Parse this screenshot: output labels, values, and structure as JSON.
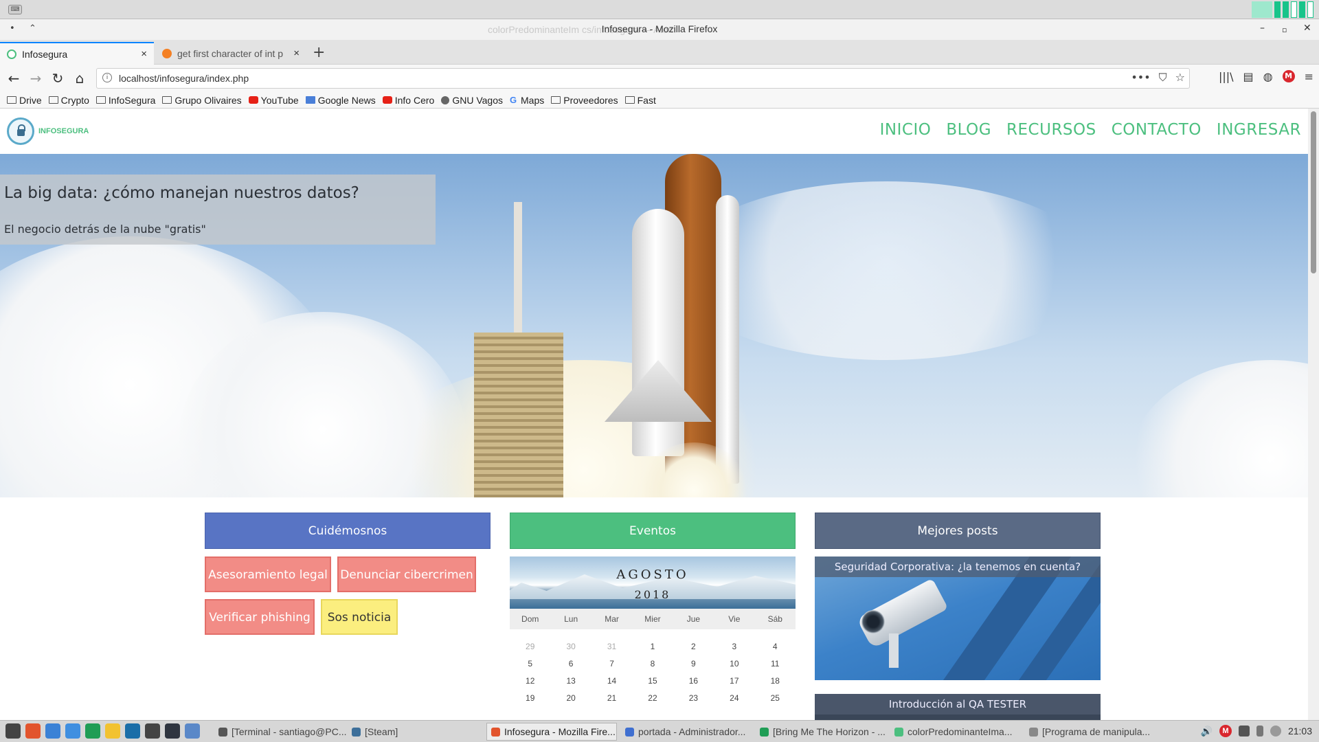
{
  "window": {
    "title": "Infosegura - Mozilla Firefox",
    "background_title": "colorPredominanteIm                                    cs/infosegura — Atom",
    "keyboard_label": "⌨"
  },
  "tabs": [
    {
      "label": "Infosegura",
      "favicon_color": "#4cbf7f",
      "close": "×"
    },
    {
      "label": "get first character of int p",
      "favicon_color": "#f48024",
      "close": "×"
    }
  ],
  "newtab": "+",
  "nav": {
    "back": "←",
    "forward": "→",
    "reload": "↻",
    "home": "⌂",
    "url": "localhost/infosegura/index.php",
    "url_icons": [
      "•••",
      "⛉",
      "☆"
    ],
    "tools": [
      "|||\\",
      "▤",
      "◍"
    ],
    "mega": "M",
    "menu": "≡"
  },
  "bookmarks": [
    {
      "label": "Drive",
      "icon": "folder-icon",
      "style": ""
    },
    {
      "label": "Crypto",
      "icon": "folder-icon",
      "style": ""
    },
    {
      "label": "InfoSegura",
      "icon": "folder-icon",
      "style": ""
    },
    {
      "label": "Grupo Olivaires",
      "icon": "folder-icon",
      "style": ""
    },
    {
      "label": "YouTube",
      "icon": "youtube-icon",
      "style": "red"
    },
    {
      "label": "Google News",
      "icon": "news-icon",
      "style": "blue"
    },
    {
      "label": "Info Cero",
      "icon": "infocero-icon",
      "style": "red"
    },
    {
      "label": "GNU Vagos",
      "icon": "gnu-icon",
      "style": "dot"
    },
    {
      "label": "Maps",
      "icon": "google-icon",
      "style": "g"
    },
    {
      "label": "Proveedores",
      "icon": "folder-icon",
      "style": ""
    },
    {
      "label": "Fast",
      "icon": "folder-icon",
      "style": ""
    }
  ],
  "site": {
    "logo_text": "INFOSEGURA",
    "menu": [
      "INICIO",
      "BLOG",
      "RECURSOS",
      "CONTACTO",
      "INGRESAR"
    ],
    "hero": {
      "title": "La big data: ¿cómo manejan nuestros datos?",
      "subtitle": "El negocio detrás de la nube \"gratis\""
    },
    "columns": {
      "care": {
        "title": "Cuidémosnos",
        "buttons": [
          "Asesoramiento legal",
          "Denunciar cibercrimen",
          "Verificar phishing",
          "Sos noticia"
        ]
      },
      "events": {
        "title": "Eventos",
        "calendar": {
          "month": "AGOSTO",
          "year": "2018",
          "weekdays": [
            "Dom",
            "Lun",
            "Mar",
            "Mier",
            "Jue",
            "Vie",
            "Sáb"
          ],
          "weeks": [
            [
              "29",
              "30",
              "31",
              "1",
              "2",
              "3",
              "4"
            ],
            [
              "5",
              "6",
              "7",
              "8",
              "9",
              "10",
              "11"
            ],
            [
              "12",
              "13",
              "14",
              "15",
              "16",
              "17",
              "18"
            ],
            [
              "19",
              "20",
              "21",
              "22",
              "23",
              "24",
              "25"
            ]
          ]
        }
      },
      "posts": {
        "title": "Mejores posts",
        "items": [
          "Seguridad Corporativa: ¿la tenemos en cuenta?",
          "Introducción al QA TESTER"
        ]
      }
    }
  },
  "taskbar": {
    "launchers": [
      {
        "icon": "menu-icon",
        "color": "#444444"
      },
      {
        "icon": "firefox-icon",
        "color": "#e2542d"
      },
      {
        "icon": "chrome-icon",
        "color": "#3b82d6"
      },
      {
        "icon": "files-icon",
        "color": "#3f8fe0"
      },
      {
        "icon": "sheets-icon",
        "color": "#1f9d55"
      },
      {
        "icon": "notes-icon",
        "color": "#f2c230"
      },
      {
        "icon": "steam-icon",
        "color": "#1b6ea8"
      },
      {
        "icon": "mixer-icon",
        "color": "#444444"
      },
      {
        "icon": "atom-icon",
        "color": "#2f3540"
      },
      {
        "icon": "window-icon",
        "color": "#5a88c8"
      }
    ],
    "tasks": [
      {
        "label": "[Terminal - santiago@PC...",
        "color": "#555555"
      },
      {
        "label": "[Steam]",
        "color": "#3d6f9a"
      },
      {
        "label": "Infosegura - Mozilla Fire...",
        "color": "#e2542d"
      },
      {
        "label": "portada - Administrador...",
        "color": "#3f6fd0"
      },
      {
        "label": "[Bring Me The Horizon - ...",
        "color": "#1f9d55"
      },
      {
        "label": "colorPredominanteIma...",
        "color": "#4cbf7f"
      },
      {
        "label": "[Programa de manipula...",
        "color": "#888888"
      }
    ],
    "tray": {
      "volume": "🔊",
      "mega": "M",
      "clock": "21:03"
    }
  }
}
